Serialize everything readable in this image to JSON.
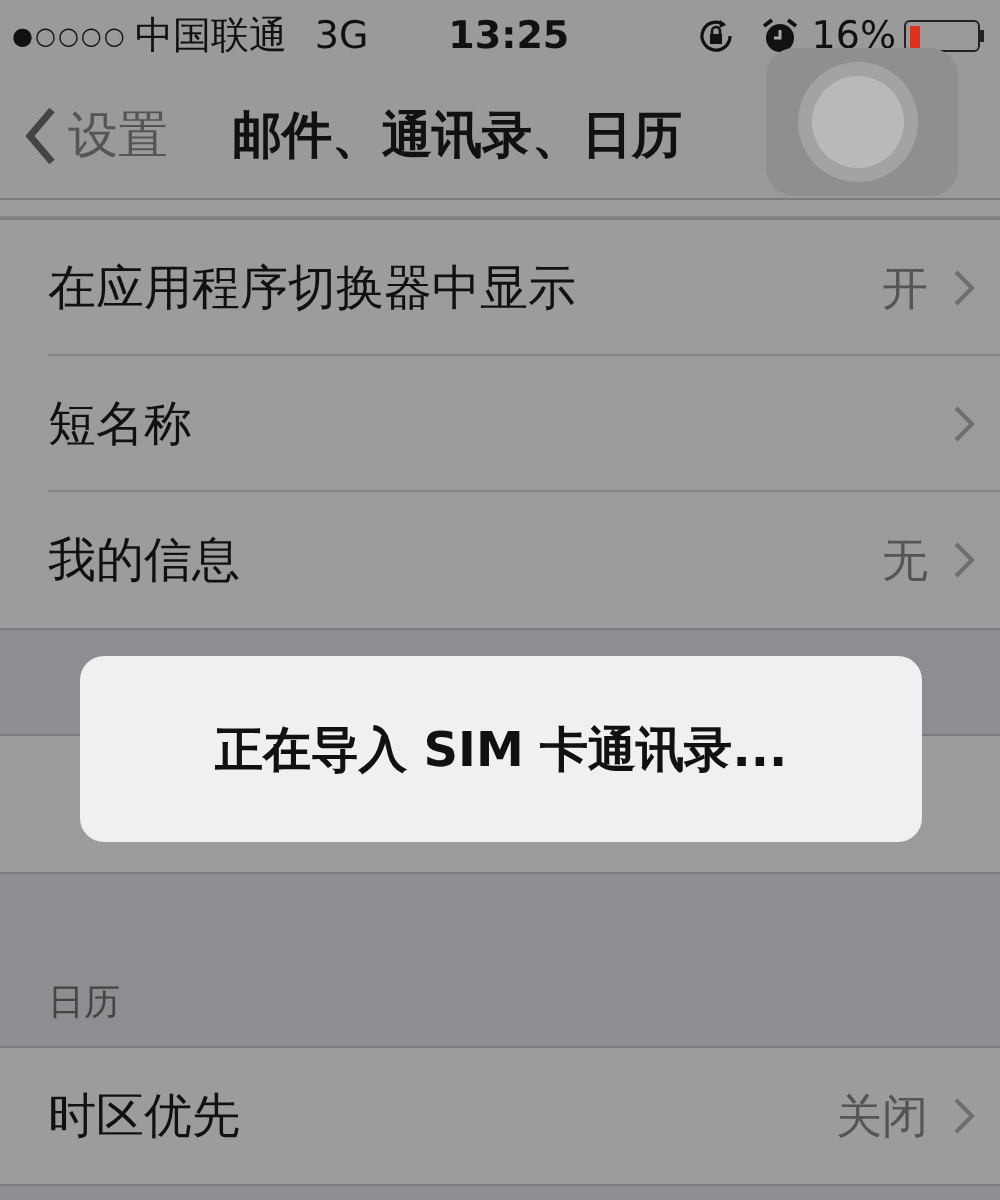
{
  "status_bar": {
    "signal": "●○○○○",
    "carrier": "中国联通",
    "network": "3G",
    "time": "13:25",
    "battery_text": "16%",
    "battery": {
      "level": 0.16
    }
  },
  "nav_bar": {
    "back_label": "设置",
    "title": "邮件、通讯录、日历"
  },
  "sections": [
    {
      "rows": [
        {
          "label": "在应用程序切换器中显示",
          "detail": "开",
          "chevron": true
        },
        {
          "label": "短名称",
          "detail": null,
          "chevron": true
        },
        {
          "label": "我的信息",
          "detail": "无",
          "chevron": true
        }
      ]
    },
    {
      "rows": [
        {
          "chevron": false
        }
      ]
    },
    {
      "header": "日历",
      "rows": [
        {
          "label": "时区优先",
          "detail": "关闭",
          "chevron": true
        }
      ]
    }
  ],
  "dialog": {
    "message": "正在导入 SIM 卡通讯录..."
  }
}
